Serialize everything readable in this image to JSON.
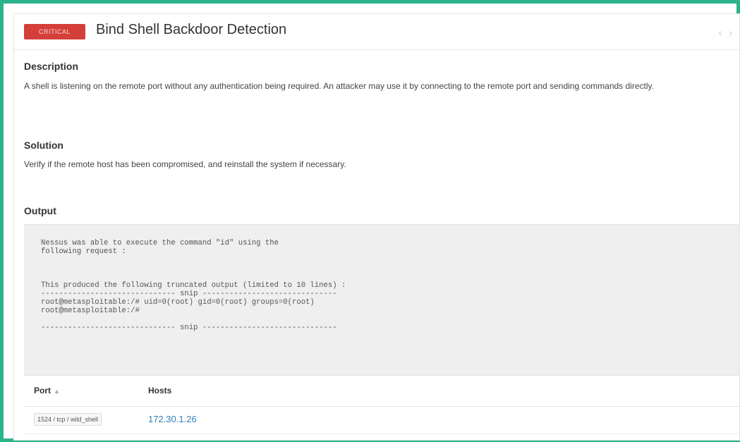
{
  "header": {
    "severity": "CRITICAL",
    "title": "Bind Shell Backdoor Detection",
    "prev_arrow": "‹",
    "next_arrow": "›"
  },
  "description": {
    "heading": "Description",
    "text": "A shell is listening on the remote port without any authentication being required. An attacker may use it by connecting to the remote port and sending commands directly."
  },
  "solution": {
    "heading": "Solution",
    "text": "Verify if the remote host has been compromised, and reinstall the system if necessary."
  },
  "output": {
    "heading": "Output",
    "text": "Nessus was able to execute the command \"id\" using the\nfollowing request :\n\n\n\nThis produced the following truncated output (limited to 10 lines) :\n------------------------------ snip ------------------------------\nroot@metasploitable:/# uid=0(root) gid=0(root) groups=0(root)\nroot@metasploitable:/#\n\n------------------------------ snip ------------------------------"
  },
  "table": {
    "col_port": "Port",
    "sort_indicator": "▲",
    "col_hosts": "Hosts",
    "rows": [
      {
        "port": "1524 / tcp / wild_shell",
        "host": "172.30.1.26"
      }
    ]
  },
  "colors": {
    "frame": "#2bb38b",
    "critical": "#d43f3a",
    "link": "#2f7fb7"
  }
}
